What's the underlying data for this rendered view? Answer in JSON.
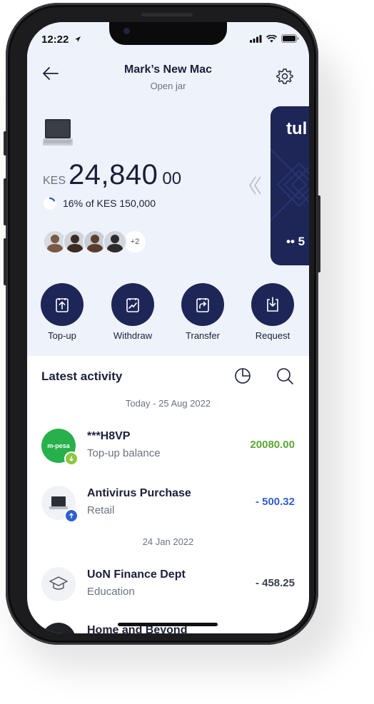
{
  "status": {
    "time": "12:22"
  },
  "header": {
    "title": "Mark’s New Mac",
    "subtitle": "Open jar"
  },
  "balance": {
    "currency": "KES",
    "main": "24,840",
    "decimals": "00"
  },
  "progress": {
    "text": "16% of KES 150,000",
    "fraction": 0.16
  },
  "members": {
    "more_label": "+2",
    "colors": [
      "#7a5a45",
      "#3b2b22",
      "#5a3d2e",
      "#2c2c2c"
    ]
  },
  "card": {
    "brand": "tul",
    "number": "•• 5"
  },
  "actions": [
    {
      "label": "Top-up",
      "icon": "top-up-icon"
    },
    {
      "label": "Withdraw",
      "icon": "withdraw-icon"
    },
    {
      "label": "Transfer",
      "icon": "transfer-icon"
    },
    {
      "label": "Request",
      "icon": "request-icon"
    }
  ],
  "activity": {
    "heading": "Latest activity",
    "groups": [
      {
        "date": "Today - 25 Aug 2022",
        "items": [
          {
            "name": "***H8VP",
            "category": "Top-up balance",
            "amount": "20080.00",
            "icon_label": "m-pesa"
          },
          {
            "name": "Antivirus Purchase",
            "category": "Retail",
            "amount": "- 500.32"
          }
        ]
      },
      {
        "date": "24 Jan 2022",
        "items": [
          {
            "name": "UoN Finance Dept",
            "category": "Education",
            "amount": "- 458.25"
          },
          {
            "name": "Home and Beyond"
          }
        ]
      }
    ]
  },
  "colors": {
    "accent": "#1d2657",
    "positive": "#5aa832",
    "negative": "#2f5fd3",
    "neutral_amount": "#3a3f4e",
    "header_bg": "#eef2fb"
  }
}
